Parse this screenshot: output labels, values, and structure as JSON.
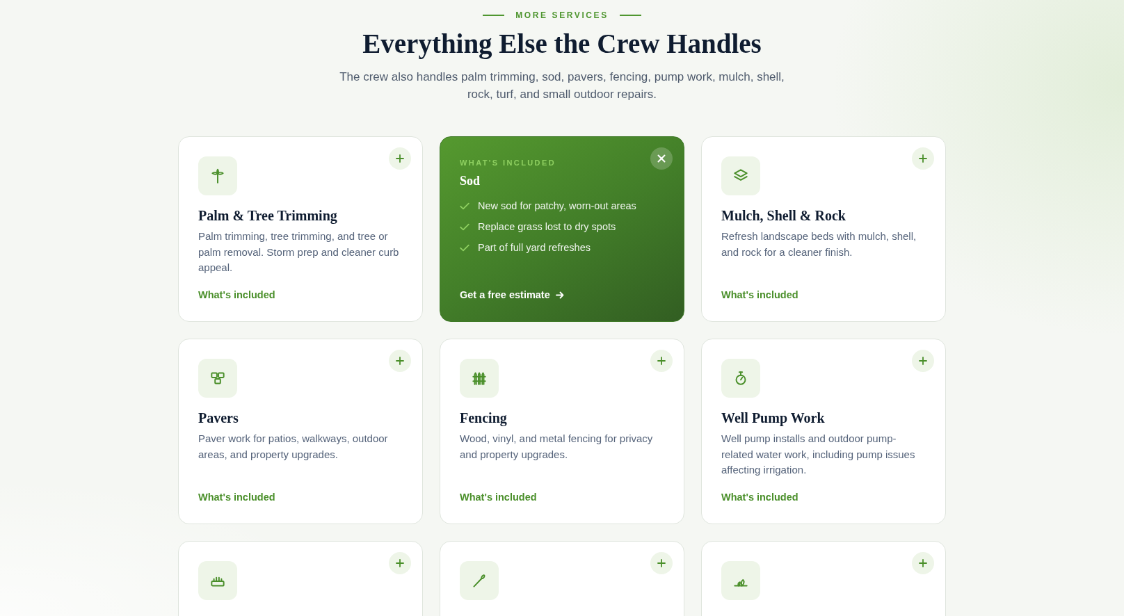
{
  "section": {
    "eyebrow": "MORE SERVICES",
    "title": "Everything Else the Crew Handles",
    "intro": "The crew also handles palm trimming, sod, pavers, fencing, pump work, mulch, shell, rock, turf, and small outdoor repairs."
  },
  "services": [
    {
      "title": "Palm & Tree Trimming",
      "description": "Palm trimming, tree trimming, and tree or palm removal. Storm prep and cleaner curb appeal.",
      "link": "What's included",
      "expanded": false
    },
    {
      "title": "Sod",
      "expanded": true,
      "panel_label": "WHAT'S INCLUDED",
      "included": [
        "New sod for patchy, worn-out areas",
        "Replace grass lost to dry spots",
        "Part of full yard refreshes"
      ],
      "cta": "Get a free estimate"
    },
    {
      "title": "Mulch, Shell & Rock",
      "description": "Refresh landscape beds with mulch, shell, and rock for a cleaner finish.",
      "link": "What's included",
      "expanded": false
    },
    {
      "title": "Pavers",
      "description": "Paver work for patios, walkways, outdoor areas, and property upgrades.",
      "link": "What's included",
      "expanded": false
    },
    {
      "title": "Fencing",
      "description": "Wood, vinyl, and metal fencing for privacy and property upgrades.",
      "link": "What's included",
      "expanded": false
    },
    {
      "title": "Well Pump Work",
      "description": "Well pump installs and outdoor pump-related water work, including pump issues affecting irrigation.",
      "link": "What's included",
      "expanded": false
    },
    {
      "expanded": false
    },
    {
      "expanded": false
    },
    {
      "expanded": false
    }
  ]
}
